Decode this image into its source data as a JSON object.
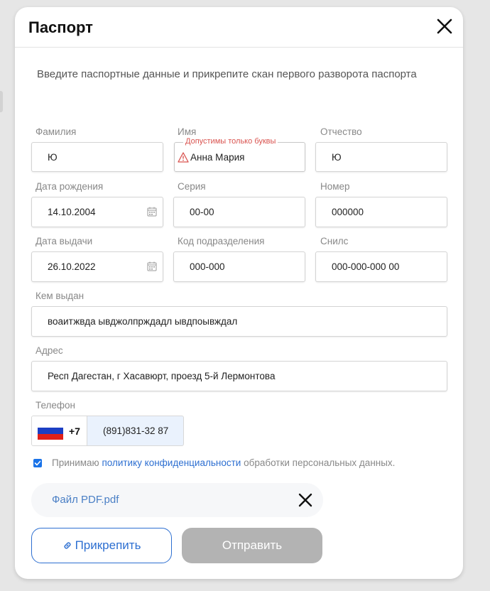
{
  "dialog": {
    "title": "Паспорт",
    "intro": "Введите паспортные данные и прикрепите скан первого разворота паспорта"
  },
  "fields": {
    "surname": {
      "label": "Фамилия",
      "value": "Ю"
    },
    "name": {
      "label": "Имя",
      "value": "Анна Мария",
      "error": "Допустимы только буквы"
    },
    "patronymic": {
      "label": "Отчество",
      "value": "Ю"
    },
    "birth_date": {
      "label": "Дата рождения",
      "value": "14.10.2004"
    },
    "series": {
      "label": "Серия",
      "value": "00-00"
    },
    "number": {
      "label": "Номер",
      "value": "000000"
    },
    "issue_date": {
      "label": "Дата выдачи",
      "value": "26.10.2022"
    },
    "division_code": {
      "label": "Код подразделения",
      "value": "000-000"
    },
    "snils": {
      "label": "Снилс",
      "value": "000-000-000 00"
    },
    "issued_by": {
      "label": "Кем выдан",
      "value": "воаитжвда ывджолпрждадл ывдпоывждал"
    },
    "address": {
      "label": "Адрес",
      "value": "Респ Дагестан, г Хасавюрт, проезд 5-й Лермонтова"
    },
    "phone": {
      "label": "Телефон",
      "country_code": "+7",
      "value": "(891)831-32 87"
    }
  },
  "consent": {
    "checked": true,
    "prefix": "Принимаю",
    "link": "политику конфиденциальности",
    "suffix": "обработки персональных данных."
  },
  "file": {
    "name": "Файл PDF.pdf"
  },
  "buttons": {
    "attach": "Прикрепить",
    "submit": "Отправить"
  },
  "colors": {
    "accent": "#2d6fd1",
    "error": "#d9534f",
    "disabled": "#b3b3b3"
  }
}
